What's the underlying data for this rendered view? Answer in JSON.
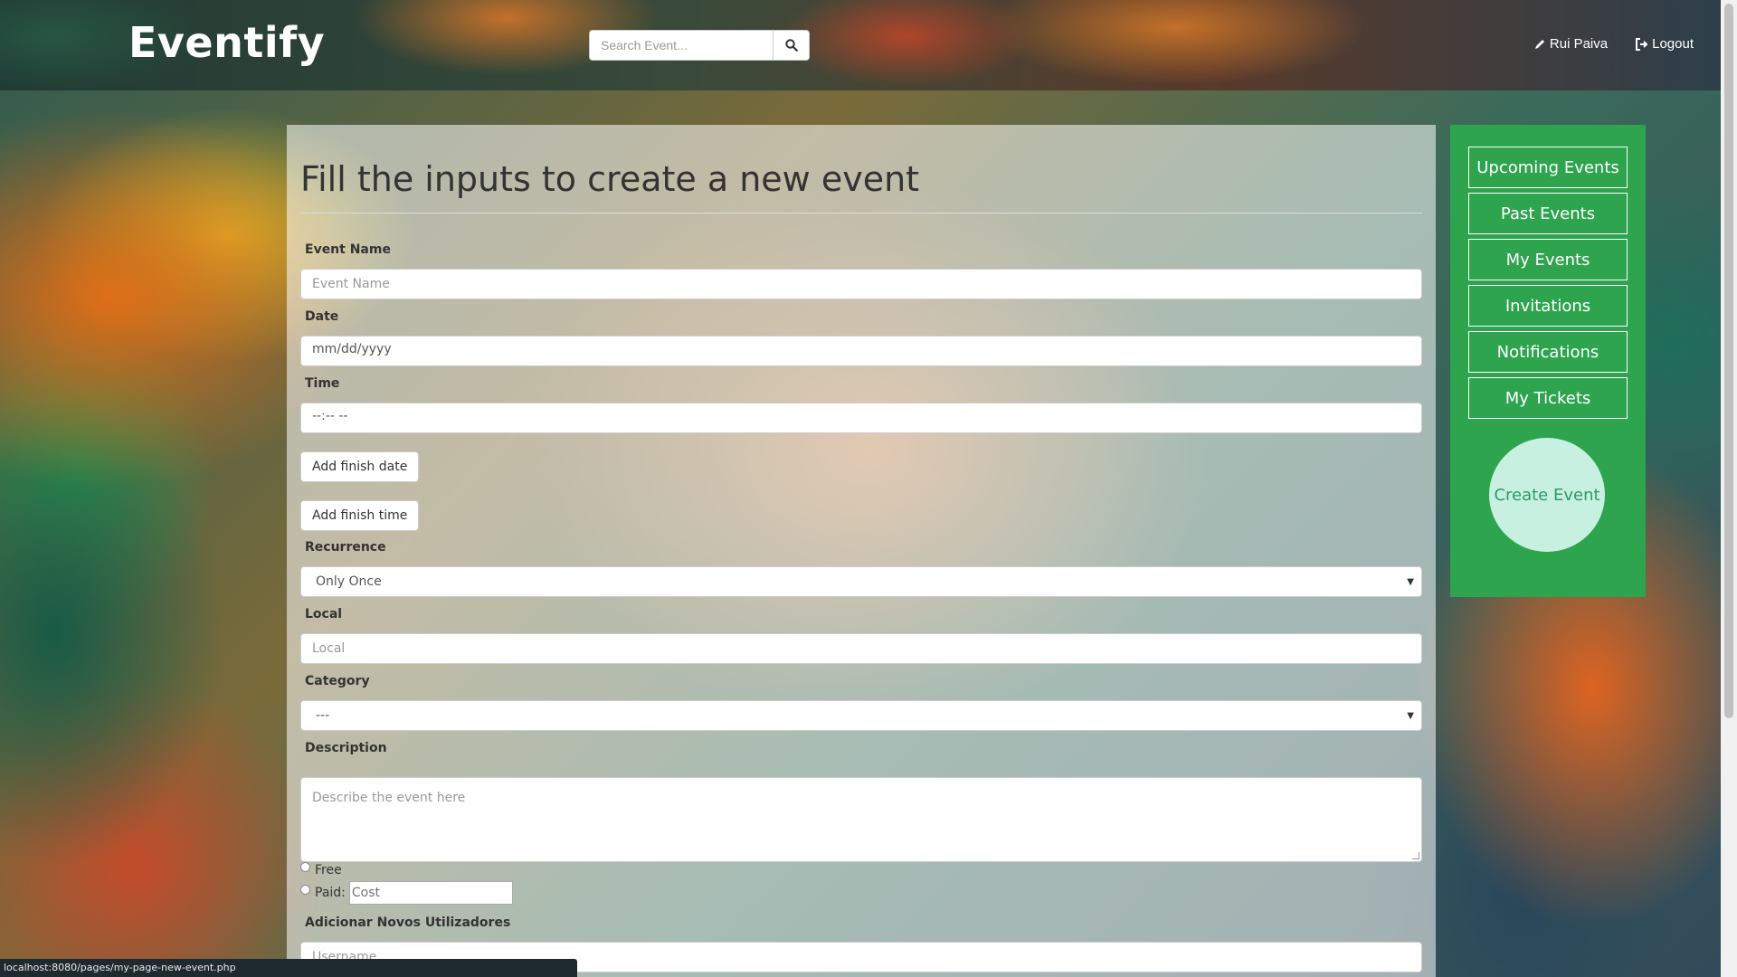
{
  "brand": {
    "name": "Eventify"
  },
  "search": {
    "placeholder": "Search Event..."
  },
  "nav": {
    "user_label": "Rui Paiva",
    "logout_label": "Logout"
  },
  "form": {
    "title": "Fill the inputs to create a new event",
    "event_name": {
      "label": "Event Name",
      "placeholder": "Event Name"
    },
    "date": {
      "label": "Date",
      "value": "mm/dd/yyyy"
    },
    "time": {
      "label": "Time",
      "value": "--:-- --"
    },
    "add_finish_date": "Add finish date",
    "add_finish_time": "Add finish time",
    "recurrence": {
      "label": "Recurrence",
      "selected": "Only Once"
    },
    "local": {
      "label": "Local",
      "placeholder": "Local"
    },
    "category": {
      "label": "Category",
      "selected": "---"
    },
    "description": {
      "label": "Description",
      "placeholder": "Describe the event here"
    },
    "price": {
      "free_label": "Free",
      "paid_label": "Paid:",
      "cost_placeholder": "Cost"
    },
    "add_users": {
      "label": "Adicionar Novos Utilizadores",
      "placeholder": "Username"
    }
  },
  "sidebar": {
    "items": [
      {
        "label": "Upcoming Events"
      },
      {
        "label": "Past Events"
      },
      {
        "label": "My Events"
      },
      {
        "label": "Invitations"
      },
      {
        "label": "Notifications"
      },
      {
        "label": "My Tickets"
      }
    ],
    "create_label": "Create Event"
  },
  "status_bar": {
    "url": "localhost:8080/pages/my-page-new-event.php"
  },
  "colors": {
    "sidebar_green": "#2ea44f",
    "create_circle": "#c8f0e0"
  }
}
